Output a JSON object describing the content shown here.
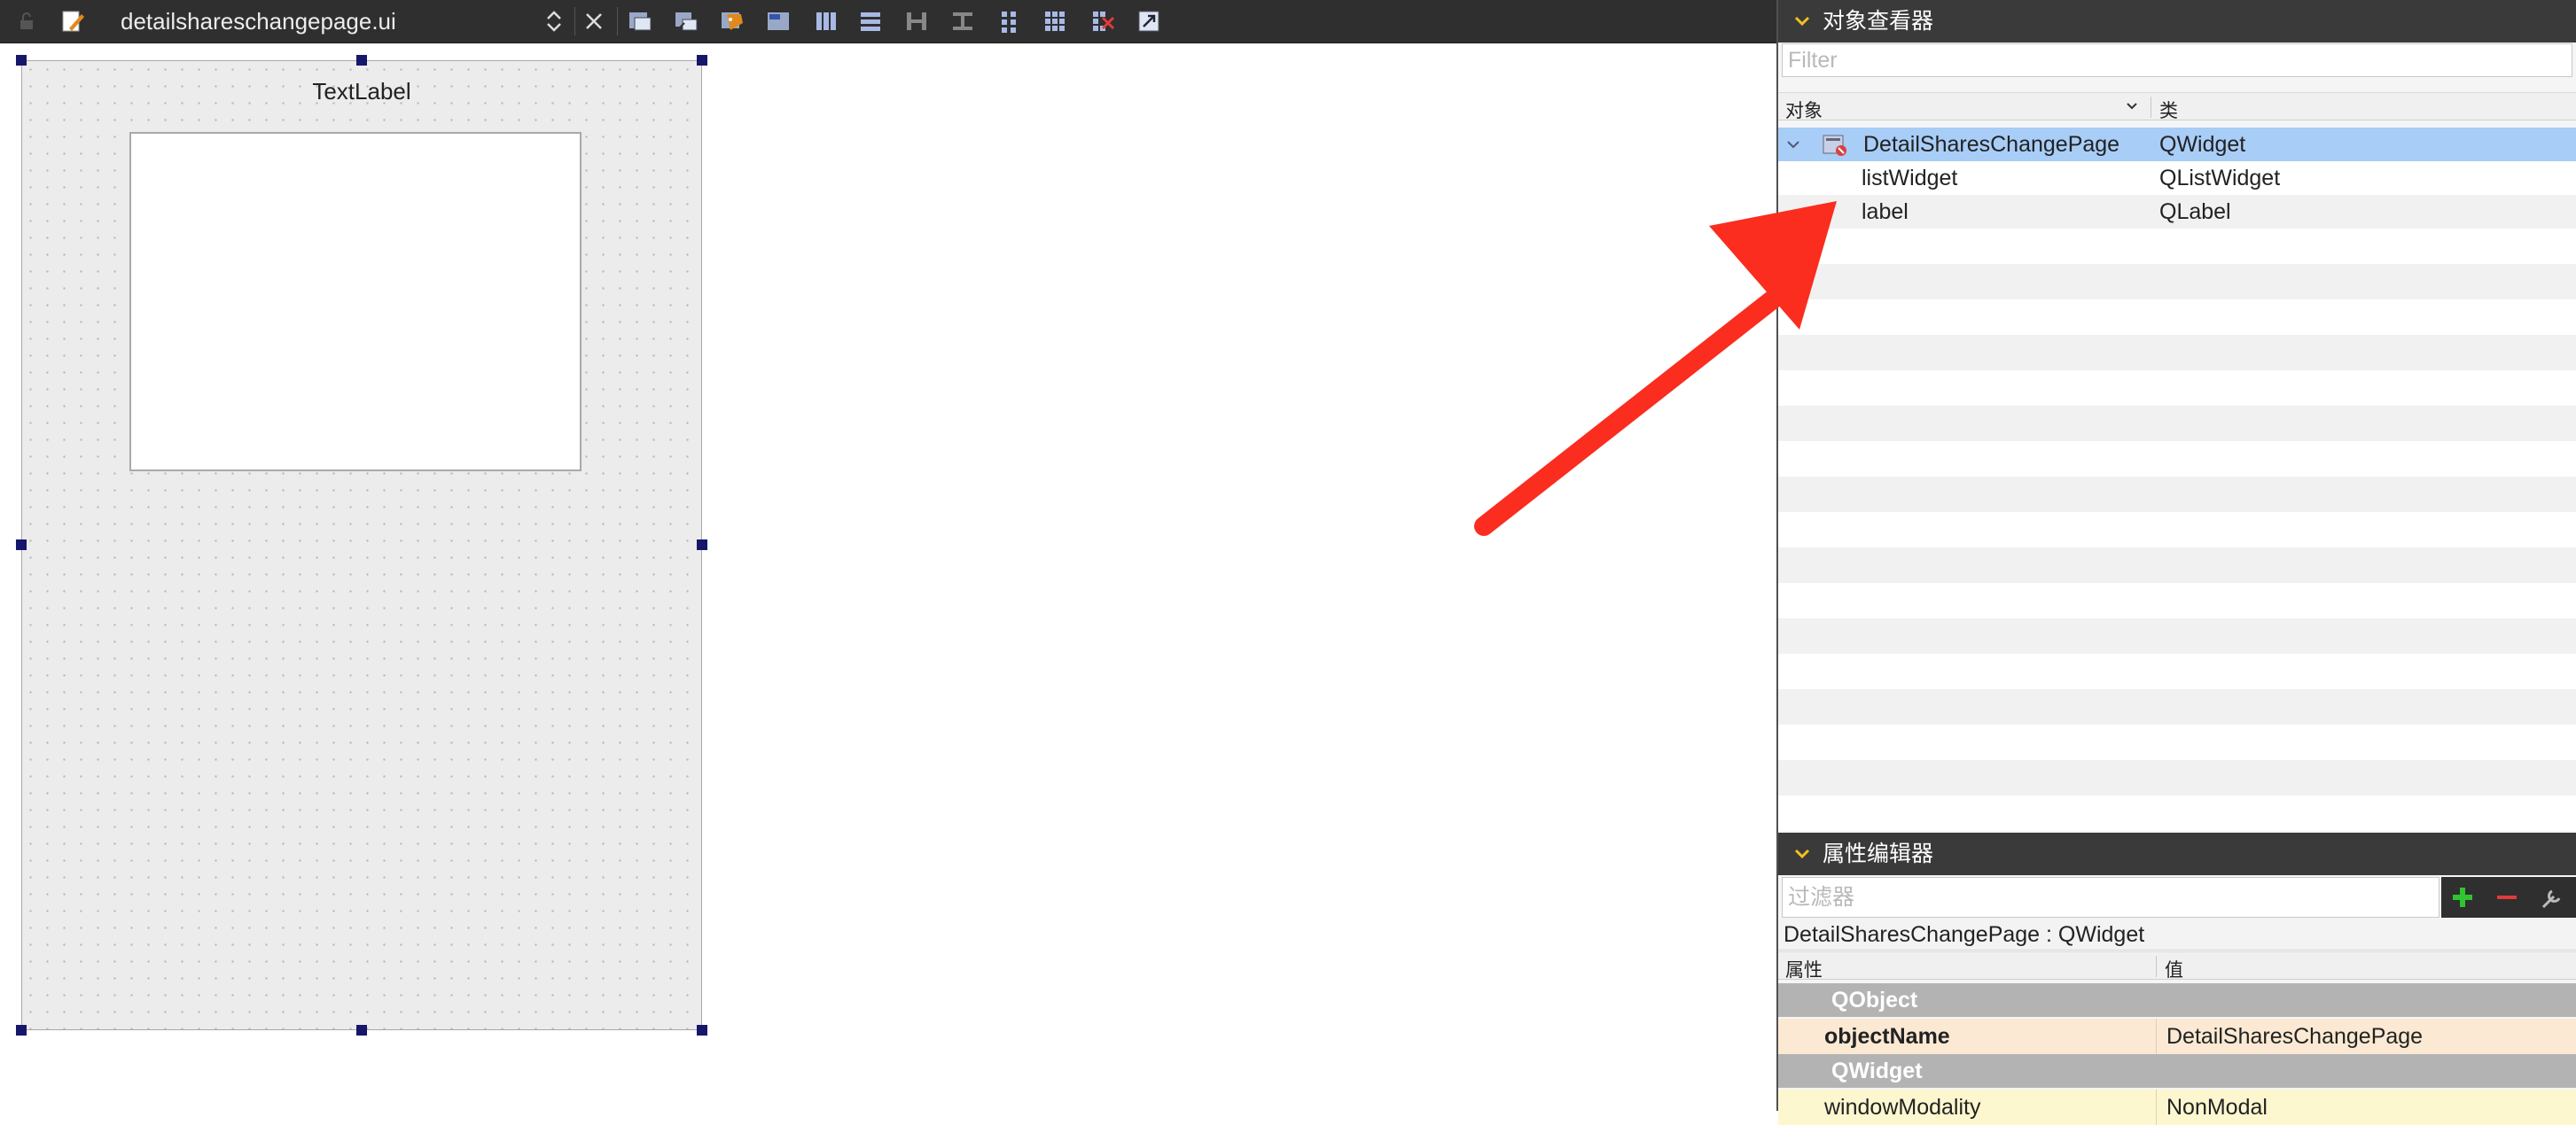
{
  "toolbar": {
    "file_name": "detailshareschangepage.ui",
    "icons": [
      "lock-icon",
      "edit-widgets-icon",
      "close-icon",
      "edit-signals-icon",
      "edit-buddies-icon",
      "edit-tab-order-icon",
      "edit-resources-icon",
      "layout-horizontal-icon",
      "layout-vertical-icon",
      "layout-horizontal-splitter-icon",
      "layout-vertical-splitter-icon",
      "layout-form-icon",
      "layout-grid-icon",
      "break-layout-icon",
      "adjust-size-icon"
    ]
  },
  "form": {
    "label_text": "TextLabel"
  },
  "object_inspector": {
    "title": "对象查看器",
    "filter_placeholder": "Filter",
    "col_object": "对象",
    "col_class": "类",
    "rows": [
      {
        "name": "DetailSharesChangePage",
        "class": "QWidget",
        "selected": true
      },
      {
        "name": "listWidget",
        "class": "QListWidget",
        "selected": false
      },
      {
        "name": "label",
        "class": "QLabel",
        "selected": false
      }
    ]
  },
  "property_editor": {
    "title": "属性编辑器",
    "filter_placeholder": "过滤器",
    "object_line": "DetailSharesChangePage : QWidget",
    "col_property": "属性",
    "col_value": "值",
    "group_qobject": "QObject",
    "object_name_key": "objectName",
    "object_name_value": "DetailSharesChangePage",
    "group_qwidget": "QWidget",
    "window_modality_key": "windowModality",
    "window_modality_value": "NonModal"
  },
  "colors": {
    "selected_row": "#a8cdf7",
    "annotation_arrow": "#fa2d1e",
    "handle": "#16166a",
    "add_button": "#2ec52e",
    "remove_button": "#e23a3a"
  }
}
